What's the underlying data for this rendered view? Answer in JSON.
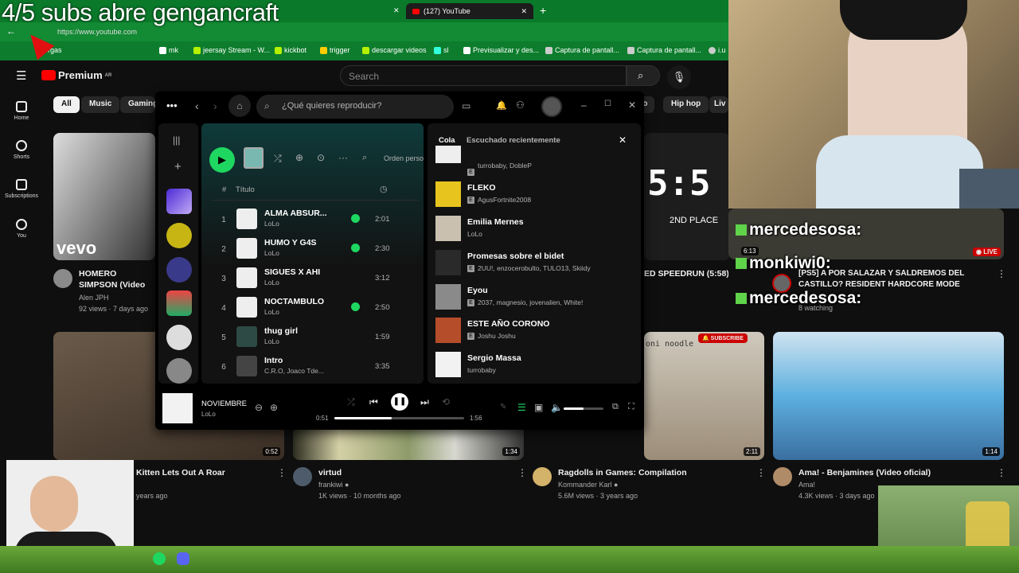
{
  "overlay": {
    "title": "4/5 subs abre gengancraft"
  },
  "browser": {
    "tab_title": "(127) YouTube",
    "url": "https://www.youtube.com",
    "bookmarks": [
      "rgas",
      "mk",
      "jeersay Stream - W...",
      "kickbot",
      "trigger",
      "descargar videos",
      "sl",
      "Previsualizar y des...",
      "Captura de pantall...",
      "Captura de pantall...",
      "i.u"
    ]
  },
  "youtube": {
    "logo": "Premium",
    "logo_sup": "AR",
    "search_placeholder": "Search",
    "sidebar": [
      "Home",
      "Shorts",
      "Subscriptions",
      "You"
    ],
    "chips": [
      "All",
      "Music",
      "Gaming",
      "to",
      "Hip hop",
      "Liv"
    ],
    "videos": [
      {
        "title": "HOMERO SIMPSON (Video Oficial)",
        "channel": "Alen JPH",
        "meta": "92 views · 7 days ago"
      },
      {
        "title": "ED SPEEDRUN (5:58)",
        "channel": "",
        "meta": ""
      },
      {
        "title": "[PS5] A POR SALAZAR Y SALDREMOS DEL CASTILLO? RESIDENT HARDCORE MODE",
        "channel": "",
        "meta": "8 watching",
        "duration": "6:13",
        "badge": "LIVE"
      },
      {
        "title": "Kitten Lets Out A Roar",
        "channel": "",
        "meta": "years ago",
        "duration": "0:52"
      },
      {
        "title": "virtud",
        "channel": "frankiwi",
        "meta": "1K views · 10 months ago",
        "duration": "1:34"
      },
      {
        "title": "Ragdolls in Games: Compilation",
        "channel": "Kommander Karl",
        "meta": "5.6M views · 3 years ago",
        "duration": "2:11"
      },
      {
        "title": "Ama! - Benjamines (Video oficial)",
        "channel": "Ama!",
        "meta": "4.3K views · 3 days ago",
        "duration": "1:14"
      }
    ],
    "thumb_text": {
      "vevo": "vevo",
      "second_place": "2ND PLACE",
      "subscribe": "SUBSCRIBE",
      "noodle": "oni noodle"
    }
  },
  "spotify": {
    "search_placeholder": "¿Qué quieres reproducir?",
    "sort_label": "Orden perso",
    "col_title": "Título",
    "tracks": [
      {
        "n": "1",
        "title": "ALMA ABSUR...",
        "artist": "LoLo",
        "saved": true,
        "dur": "2:01"
      },
      {
        "n": "2",
        "title": "HUMO Y G4S",
        "artist": "LoLo",
        "saved": true,
        "dur": "2:30"
      },
      {
        "n": "3",
        "title": "SIGUES X AHI",
        "artist": "LoLo",
        "saved": false,
        "dur": "3:12"
      },
      {
        "n": "4",
        "title": "NOCTAMBULO",
        "artist": "LoLo",
        "saved": true,
        "dur": "2:50"
      },
      {
        "n": "5",
        "title": "thug girl",
        "artist": "LoLo",
        "saved": false,
        "dur": "1:59"
      },
      {
        "n": "6",
        "title": "Intro",
        "artist": "C.R.O, Joaco Tde...",
        "saved": false,
        "dur": "3:35"
      }
    ],
    "queue_tabs": [
      "Cola",
      "Escuchado recientemente"
    ],
    "queue": [
      {
        "title": "",
        "artist": "turrobaby, DobleP"
      },
      {
        "title": "FLEKO",
        "artist": "AgusFortnite2008"
      },
      {
        "title": "Emilia Mernes",
        "artist": "LoLo"
      },
      {
        "title": "Promesas sobre el bidet",
        "artist": "2UU!, enzocerobulto, TULO13, Skiidy"
      },
      {
        "title": "Eyou",
        "artist": "2037, magnesio, jovenalien, White!"
      },
      {
        "title": "ESTE AÑO CORONO",
        "artist": "Joshu Joshu"
      },
      {
        "title": "Sergio Massa",
        "artist": "turrobaby"
      }
    ],
    "now_playing": {
      "title": "NOVIEMBRE",
      "artist": "LoLo",
      "elapsed": "0:51",
      "total": "1:56",
      "progress": 0.44,
      "volume": 0.5
    }
  },
  "chat": [
    {
      "user": "mercedesosa:"
    },
    {
      "user": "monkiwi0:"
    },
    {
      "user": "mercedesosa:"
    }
  ],
  "colors": {
    "spotify_green": "#1ed760",
    "yt_red": "#ff0000",
    "live_red": "#cc0000"
  }
}
